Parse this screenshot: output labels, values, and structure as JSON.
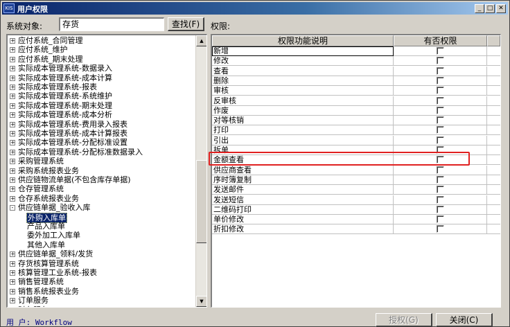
{
  "window": {
    "title": "用户权限",
    "app_icon": "KIS"
  },
  "titlebar_buttons": {
    "minimize": "_",
    "maximize": "□",
    "close": "✕"
  },
  "toolbar": {
    "object_label": "系统对象:",
    "object_value": "存货",
    "find_button": "查找(F)",
    "perm_label": "权限:"
  },
  "tree": {
    "items": [
      {
        "label": "应付系统_合同管理",
        "expand": "+"
      },
      {
        "label": "应付系统_维护",
        "expand": "+"
      },
      {
        "label": "应付系统_期末处理",
        "expand": "+"
      },
      {
        "label": "实际成本管理系统-数据录入",
        "expand": "+"
      },
      {
        "label": "实际成本管理系统-成本计算",
        "expand": "+"
      },
      {
        "label": "实际成本管理系统-报表",
        "expand": "+"
      },
      {
        "label": "实际成本管理系统-系统维护",
        "expand": "+"
      },
      {
        "label": "实际成本管理系统-期末处理",
        "expand": "+"
      },
      {
        "label": "实际成本管理系统-成本分析",
        "expand": "+"
      },
      {
        "label": "实际成本管理系统-费用录入报表",
        "expand": "+"
      },
      {
        "label": "实际成本管理系统-成本计算报表",
        "expand": "+"
      },
      {
        "label": "实际成本管理系统-分配标准设置",
        "expand": "+"
      },
      {
        "label": "实际成本管理系统-分配标准数据录入",
        "expand": "+"
      },
      {
        "label": "采购管理系统",
        "expand": "+"
      },
      {
        "label": "采购系统报表业务",
        "expand": "+"
      },
      {
        "label": "供应链物流单据(不包含库存单据)",
        "expand": "+"
      },
      {
        "label": "仓存管理系统",
        "expand": "+"
      },
      {
        "label": "仓存系统报表业务",
        "expand": "+"
      },
      {
        "label": "供应链单据_验收入库",
        "expand": "-"
      },
      {
        "label": "外购入库单",
        "expand": "",
        "child": true,
        "selected": true
      },
      {
        "label": "产品入库单",
        "expand": "",
        "child": true
      },
      {
        "label": "委外加工入库单",
        "expand": "",
        "child": true
      },
      {
        "label": "其他入库单",
        "expand": "",
        "child": true
      },
      {
        "label": "供应链单据_领料/发货",
        "expand": "+"
      },
      {
        "label": "存货核算管理系统",
        "expand": "+"
      },
      {
        "label": "核算管理工业系统-报表",
        "expand": "+"
      },
      {
        "label": "销售管理系统",
        "expand": "+"
      },
      {
        "label": "销售系统报表业务",
        "expand": "+"
      },
      {
        "label": "订单服务",
        "expand": "+"
      },
      {
        "label": "财务服务",
        "expand": "+"
      }
    ]
  },
  "grid": {
    "headers": {
      "function": "权限功能说明",
      "has_permission": "有否权限"
    },
    "rows": [
      {
        "label": "新增",
        "checked": false
      },
      {
        "label": "修改",
        "checked": false
      },
      {
        "label": "查看",
        "checked": false
      },
      {
        "label": "删除",
        "checked": false
      },
      {
        "label": "审核",
        "checked": false
      },
      {
        "label": "反审核",
        "checked": false
      },
      {
        "label": "作废",
        "checked": false
      },
      {
        "label": "对等核销",
        "checked": false
      },
      {
        "label": "打印",
        "checked": false
      },
      {
        "label": "引出",
        "checked": false
      },
      {
        "label": "拆单",
        "checked": false
      },
      {
        "label": "金额查看",
        "checked": false
      },
      {
        "label": "供应商查看",
        "checked": false
      },
      {
        "label": "序时簿复制",
        "checked": false
      },
      {
        "label": "发送邮件",
        "checked": false
      },
      {
        "label": "发送短信",
        "checked": false
      },
      {
        "label": "二维码打印",
        "checked": false
      },
      {
        "label": "单价修改",
        "checked": false
      },
      {
        "label": "折扣修改",
        "checked": false
      }
    ]
  },
  "footer": {
    "user_label": "用  户:",
    "user_value": "Workflow",
    "grant_button": "授权(G)",
    "close_button": "关闭(C)"
  },
  "colors": {
    "highlight_box": "#e02020",
    "selection": "#0a246a",
    "title_gradient_start": "#0a246a"
  }
}
